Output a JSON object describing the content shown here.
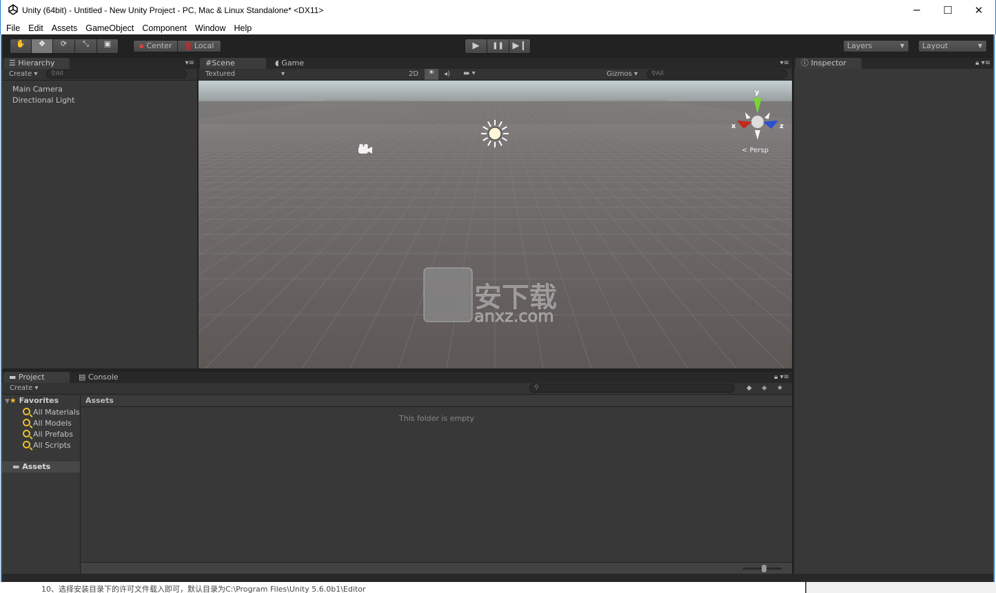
{
  "window": {
    "title": "Unity (64bit) - Untitled - New Unity Project - PC, Mac & Linux Standalone* <DX11>",
    "minimize": "─",
    "maximize": "☐",
    "close": "✕"
  },
  "menu": [
    "File",
    "Edit",
    "Assets",
    "GameObject",
    "Component",
    "Window",
    "Help"
  ],
  "toolbar": {
    "tools": [
      "hand-tool",
      "move-tool",
      "rotate-tool",
      "scale-tool",
      "rect-tool"
    ],
    "active_tool": "move-tool",
    "pivot": "Center",
    "space": "Local",
    "play": "▶",
    "pause": "❚❚",
    "step": "▶❙",
    "layers": "Layers",
    "layout": "Layout"
  },
  "hierarchy": {
    "tab": "Hierarchy",
    "create": "Create",
    "search_placeholder": "All",
    "items": [
      "Main Camera",
      "Directional Light"
    ]
  },
  "scene": {
    "tabs": [
      "Scene",
      "Game"
    ],
    "active_tab": "Scene",
    "shading": "Textured",
    "mode_2d": "2D",
    "gizmos": "Gizmos",
    "search_placeholder": "All",
    "projection": "Persp",
    "axes": {
      "x": "x",
      "y": "y",
      "z": "z"
    },
    "sky_color": "#b5c0c2",
    "ground_color": "#5f5a58"
  },
  "inspector": {
    "tab": "Inspector"
  },
  "project": {
    "tabs": [
      "Project",
      "Console"
    ],
    "active_tab": "Project",
    "create": "Create",
    "favorites_label": "Favorites",
    "favorites": [
      "All Materials",
      "All Models",
      "All Prefabs",
      "All Scripts"
    ],
    "assets_label": "Assets",
    "breadcrumb": "Assets",
    "empty_message": "This folder is empty"
  },
  "watermark": {
    "text": "安下载",
    "url": "anxz.com"
  },
  "background_doc_text": "10、选择安装目录下的许可文件载入即可，默认目录为C:\\Program Files\\Unity 5.6.0b1\\Editor",
  "colors": {
    "accent": "#1e78d0",
    "panel": "#383838",
    "toolbar": "#222222"
  }
}
